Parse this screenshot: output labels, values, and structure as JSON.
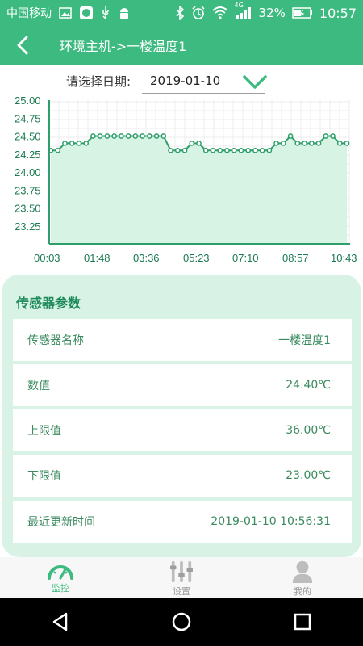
{
  "status_bar": {
    "carrier": "中国移动",
    "network": "4G",
    "battery": "32%",
    "time": "10:57",
    "icons": [
      "image-icon",
      "app-badge-icon",
      "usb-icon",
      "android-icon",
      "bluetooth-icon",
      "alarm-icon",
      "wifi-icon",
      "signal-icon",
      "battery-icon"
    ]
  },
  "app_bar": {
    "title": "环境主机->一楼温度1"
  },
  "date_picker": {
    "label": "请选择日期:",
    "value": "2019-01-10"
  },
  "chart_data": {
    "type": "area",
    "title": "",
    "xlabel": "",
    "ylabel": "",
    "ylim": [
      23.0,
      25.0
    ],
    "y_ticks": [
      "25.00",
      "24.75",
      "24.50",
      "24.25",
      "24.00",
      "23.75",
      "23.50",
      "23.25"
    ],
    "x_ticks": [
      "00:03",
      "01:48",
      "03:36",
      "05:23",
      "07:10",
      "08:57",
      "10:43"
    ],
    "grid": true,
    "colors": {
      "line": "#2e9e6a",
      "fill": "#d6f3e4",
      "axis": "#2e9e6a"
    },
    "series": [
      {
        "values": [
          24.3,
          24.3,
          24.4,
          24.4,
          24.4,
          24.4,
          24.5,
          24.5,
          24.5,
          24.5,
          24.5,
          24.5,
          24.5,
          24.5,
          24.5,
          24.5,
          24.5,
          24.3,
          24.3,
          24.3,
          24.4,
          24.4,
          24.3,
          24.3,
          24.3,
          24.3,
          24.3,
          24.3,
          24.3,
          24.3,
          24.3,
          24.3,
          24.4,
          24.4,
          24.5,
          24.4,
          24.4,
          24.4,
          24.4,
          24.5,
          24.5,
          24.4,
          24.4
        ]
      }
    ]
  },
  "params": {
    "title": "传感器参数",
    "rows": [
      {
        "label": "传感器名称",
        "value": "一楼温度1"
      },
      {
        "label": "数值",
        "value": "24.40℃"
      },
      {
        "label": "上限值",
        "value": "36.00℃"
      },
      {
        "label": "下限值",
        "value": "23.00℃"
      },
      {
        "label": "最近更新时间",
        "value": "2019-01-10 10:56:31"
      }
    ]
  },
  "bottom_nav": {
    "items": [
      {
        "label": "监控",
        "icon": "gauge-icon",
        "active": true
      },
      {
        "label": "设置",
        "icon": "sliders-icon",
        "active": false
      },
      {
        "label": "我的",
        "icon": "person-icon",
        "active": false
      }
    ]
  },
  "colors": {
    "primary": "#3dba80",
    "card_bg": "#d8f3e5",
    "text_green": "#3a8a5e"
  }
}
